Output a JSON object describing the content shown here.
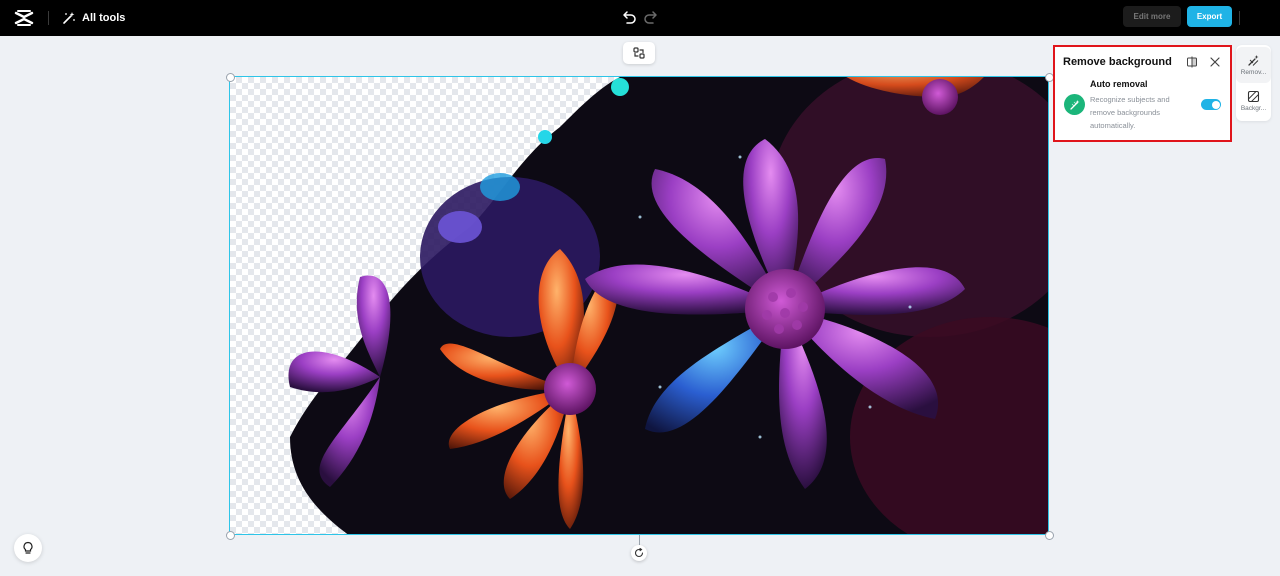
{
  "topbar": {
    "all_tools_label": "All tools",
    "edit_more_label": "Edit more",
    "export_label": "Export",
    "accent_color": "#1fb3e6"
  },
  "panel": {
    "title": "Remove background",
    "auto_removal": {
      "title": "Auto removal",
      "description": "Recognize subjects and remove backgrounds automatically.",
      "enabled": true
    }
  },
  "rail": {
    "items": [
      {
        "label": "Remov...",
        "icon": "remove-background-icon",
        "active": true
      },
      {
        "label": "Backgr...",
        "icon": "background-icon",
        "active": false
      }
    ]
  },
  "icons": {
    "logo": "capcut-logo",
    "undo": "undo-icon",
    "redo": "redo-icon",
    "swap": "swap-icon",
    "rotate": "rotate-icon",
    "tips": "lightbulb-icon",
    "compare": "compare-icon",
    "close": "close-icon"
  }
}
